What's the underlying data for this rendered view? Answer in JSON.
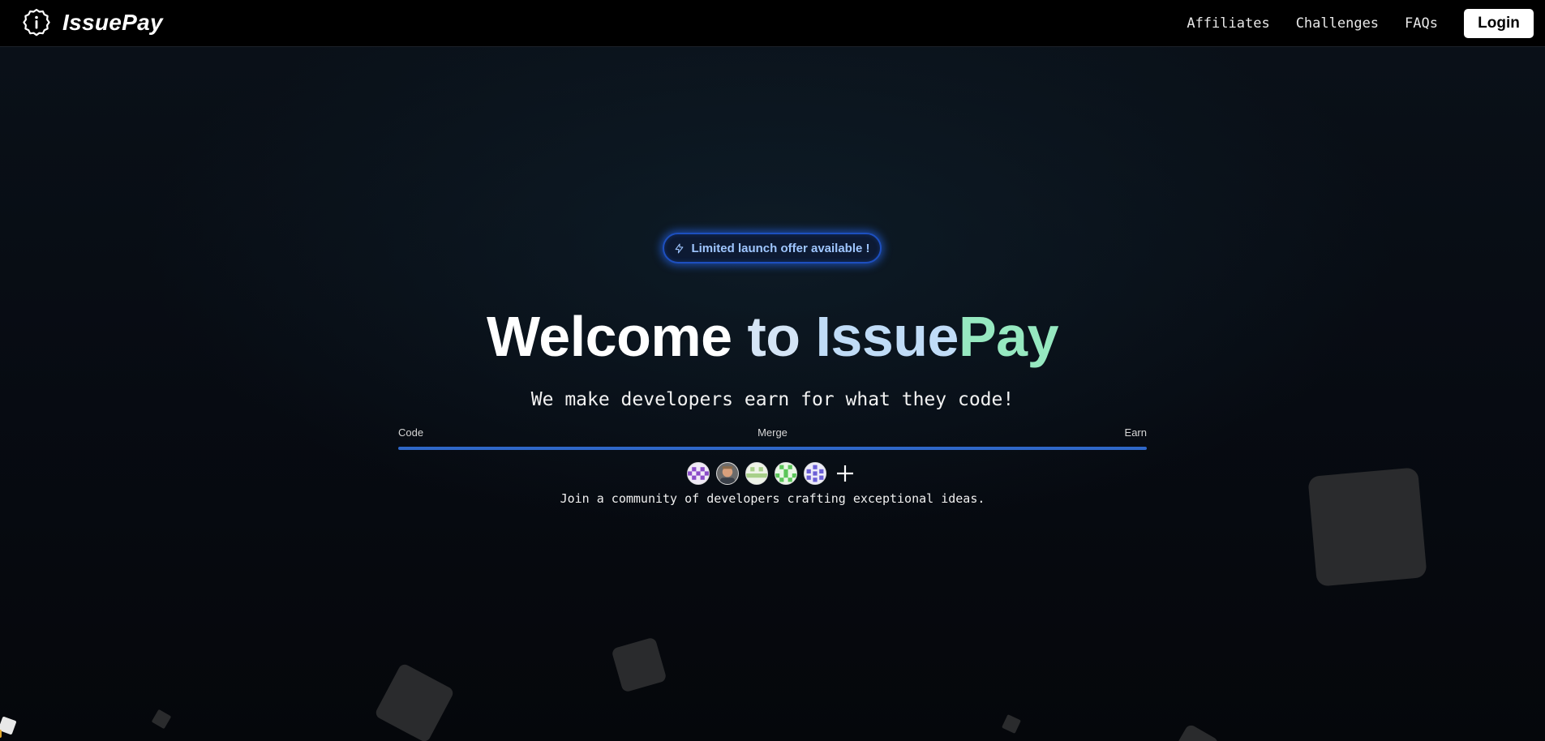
{
  "nav": {
    "brand": "IssuePay",
    "links": [
      "Affiliates",
      "Challenges",
      "FAQs"
    ],
    "login_label": "Login"
  },
  "hero": {
    "badge_text": "Limited launch offer available !",
    "title_parts": [
      "Welcome",
      "to",
      "Issue",
      "Pay"
    ],
    "subtitle": "We make developers earn for what they code!",
    "steps": [
      "Code",
      "Merge",
      "Earn"
    ],
    "community_text": "Join a community of developers crafting exceptional ideas."
  },
  "colors": {
    "background": "#05080d",
    "accent_blue": "#2f67c8",
    "badge_text": "#9fc6ff",
    "title_green": "#96e8c0"
  },
  "icons": {
    "logo": "info-circle-badge-icon",
    "badge": "lightning-icon",
    "more": "plus-icon"
  }
}
